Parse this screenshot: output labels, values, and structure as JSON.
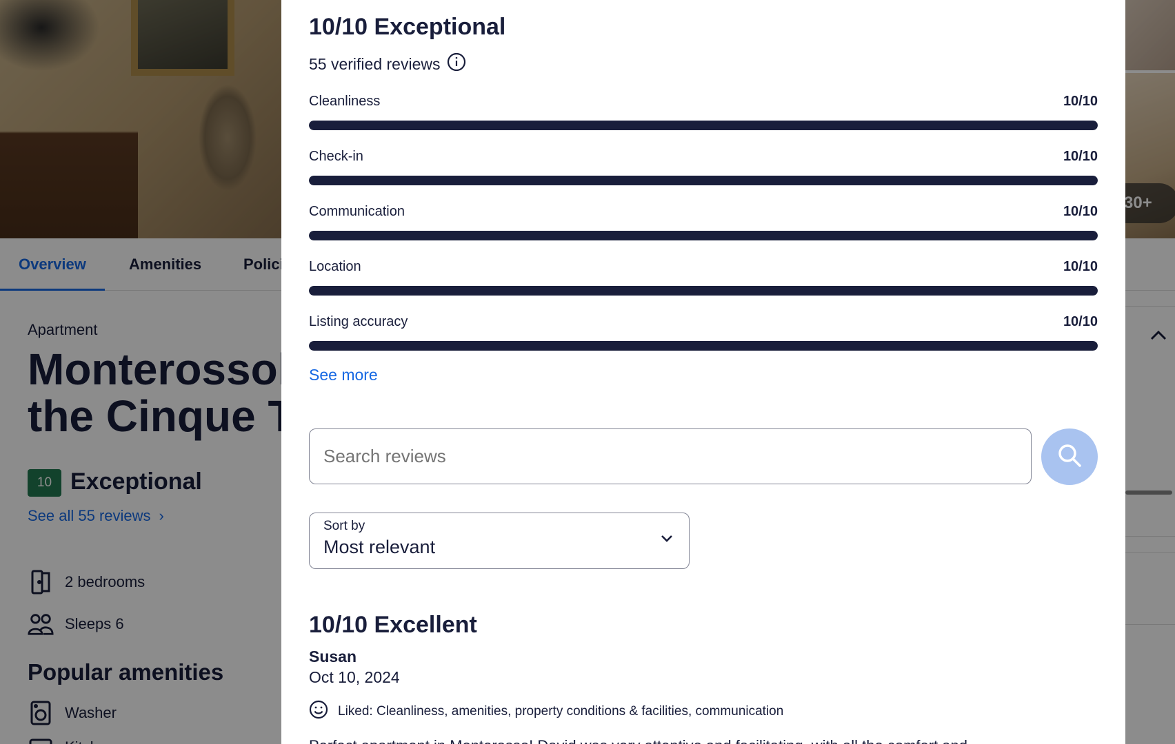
{
  "background": {
    "photo_count": "30+",
    "tabs": [
      "Overview",
      "Amenities",
      "Polici"
    ],
    "property_type": "Apartment",
    "title_line1": "Monterossoh",
    "title_line2": "the Cinque Te",
    "score": "10",
    "score_word": "Exceptional",
    "see_all_reviews": "See all 55 reviews",
    "facts": [
      {
        "icon": "door-icon",
        "text": "2 bedrooms"
      },
      {
        "icon": "people-icon",
        "text": "Sleeps 6"
      }
    ],
    "popular_amenities_title": "Popular amenities",
    "amenities": [
      {
        "icon": "washer-icon",
        "text": "Washer"
      },
      {
        "icon": "kitchen-icon",
        "text": "Kitchen"
      }
    ]
  },
  "modal": {
    "title": "10/10 Exceptional",
    "verified": "55 verified reviews",
    "categories": [
      {
        "label": "Cleanliness",
        "value": "10/10",
        "fraction": 1.0
      },
      {
        "label": "Check-in",
        "value": "10/10",
        "fraction": 1.0
      },
      {
        "label": "Communication",
        "value": "10/10",
        "fraction": 1.0
      },
      {
        "label": "Location",
        "value": "10/10",
        "fraction": 1.0
      },
      {
        "label": "Listing accuracy",
        "value": "10/10",
        "fraction": 1.0
      }
    ],
    "see_more": "See more",
    "search_placeholder": "Search reviews",
    "sort_label": "Sort by",
    "sort_value": "Most relevant",
    "review": {
      "title": "10/10 Excellent",
      "author": "Susan",
      "date": "Oct 10, 2024",
      "liked": "Liked: Cleanliness, amenities, property conditions & facilities, communication",
      "body": "Perfect apartment in Monterosso! David was very attentive and facilitating, with all the comfort and"
    }
  },
  "colors": {
    "accent": "#1668e3",
    "text": "#191e3b",
    "badge": "#227950",
    "bar": "#191e3b",
    "search_button": "#a9c3f0"
  }
}
